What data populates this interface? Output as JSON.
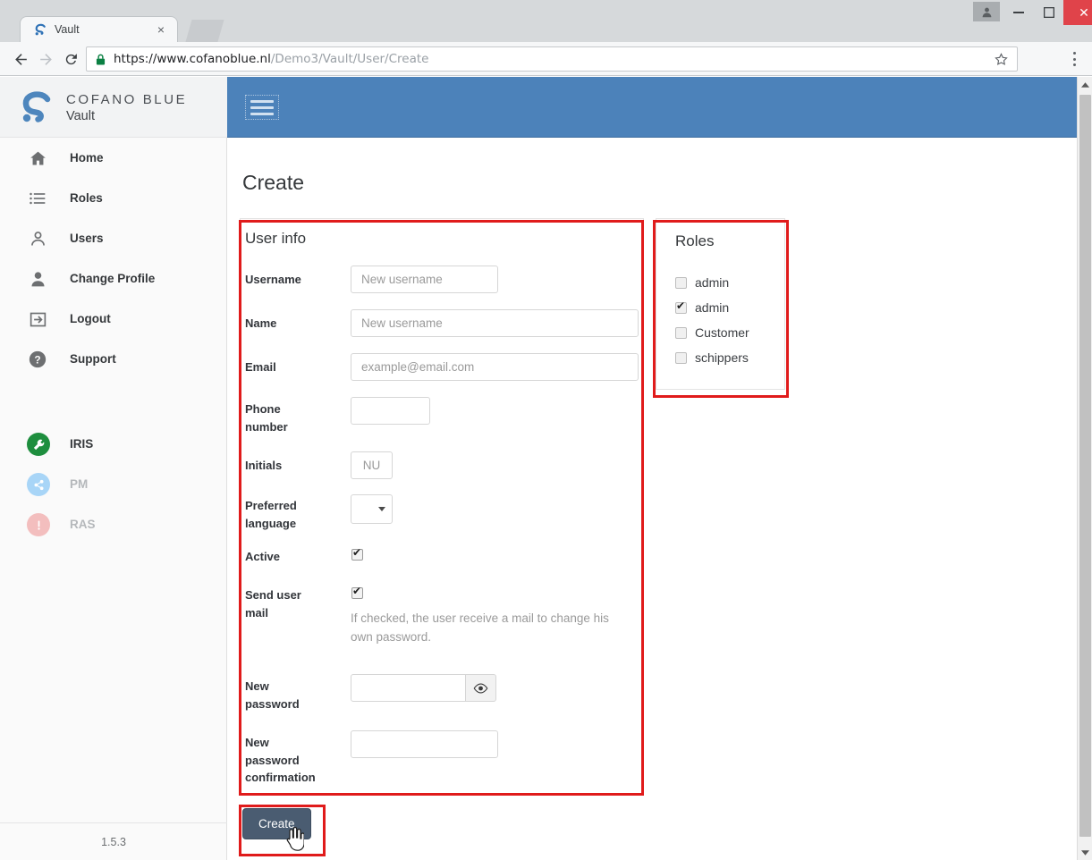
{
  "browser": {
    "tab": {
      "title": "Vault",
      "favicon": "cofano-logo-icon",
      "close": "×"
    },
    "newtab_label": "",
    "nav": {
      "back": "back-icon",
      "forward": "forward-icon",
      "reload": "reload-icon"
    },
    "url": {
      "scheme_host": "https://www.cofanoblue.nl",
      "path": "/Demo3/Vault/User/Create",
      "lock": "lock-icon"
    },
    "window": {
      "minimize": "–",
      "maximize": "□",
      "close": "✕",
      "profile": "profile-icon"
    }
  },
  "sidebar": {
    "brand": {
      "name": "COFANO BLUE",
      "sub": "Vault",
      "logo": "cofano-logo-icon"
    },
    "items": [
      {
        "label": "Home",
        "icon": "home-icon"
      },
      {
        "label": "Roles",
        "icon": "list-icon"
      },
      {
        "label": "Users",
        "icon": "user-outline-icon"
      },
      {
        "label": "Change Profile",
        "icon": "user-solid-icon"
      },
      {
        "label": "Logout",
        "icon": "logout-icon"
      },
      {
        "label": "Support",
        "icon": "question-circle-icon"
      }
    ],
    "apps": [
      {
        "label": "IRIS",
        "icon": "wrench-icon",
        "color": "#1e8e3e",
        "enabled": true
      },
      {
        "label": "PM",
        "icon": "share-nodes-icon",
        "color": "#a8d5f7",
        "enabled": false
      },
      {
        "label": "RAS",
        "icon": "exclamation-icon",
        "color": "#f3bebe",
        "enabled": false
      }
    ],
    "version": "1.5.3"
  },
  "topbar": {
    "menu_toggle": "hamburger-icon",
    "accent": "#4c82ba"
  },
  "main": {
    "page_title": "Create",
    "user_info": {
      "title": "User info",
      "fields": [
        {
          "label": "Username",
          "placeholder": "New username",
          "value": "",
          "type": "text"
        },
        {
          "label": "Name",
          "placeholder": "New username",
          "value": "",
          "type": "text"
        },
        {
          "label": "Email",
          "placeholder": "example@email.com",
          "value": "",
          "type": "text"
        },
        {
          "label": "Phone number",
          "placeholder": "",
          "value": "",
          "type": "text"
        },
        {
          "label": "Initials",
          "placeholder": "NU",
          "value": "",
          "type": "text"
        },
        {
          "label": "Preferred language",
          "value": "",
          "type": "select"
        },
        {
          "label": "Active",
          "checked": true,
          "type": "checkbox"
        },
        {
          "label": "Send user mail",
          "checked": true,
          "type": "checkbox",
          "help": "If checked, the user receive a mail to change his own password."
        },
        {
          "label": "New password",
          "placeholder": "",
          "value": "",
          "type": "password",
          "toggle_icon": "eye-icon"
        },
        {
          "label": "New password confirmation",
          "placeholder": "",
          "value": "",
          "type": "password"
        }
      ]
    },
    "roles": {
      "title": "Roles",
      "items": [
        {
          "label": "admin",
          "checked": false
        },
        {
          "label": "admin",
          "checked": true
        },
        {
          "label": "Customer",
          "checked": false
        },
        {
          "label": "schippers",
          "checked": false
        }
      ]
    },
    "submit_label": "Create"
  },
  "annotations": {
    "color": "#e01b1b"
  }
}
